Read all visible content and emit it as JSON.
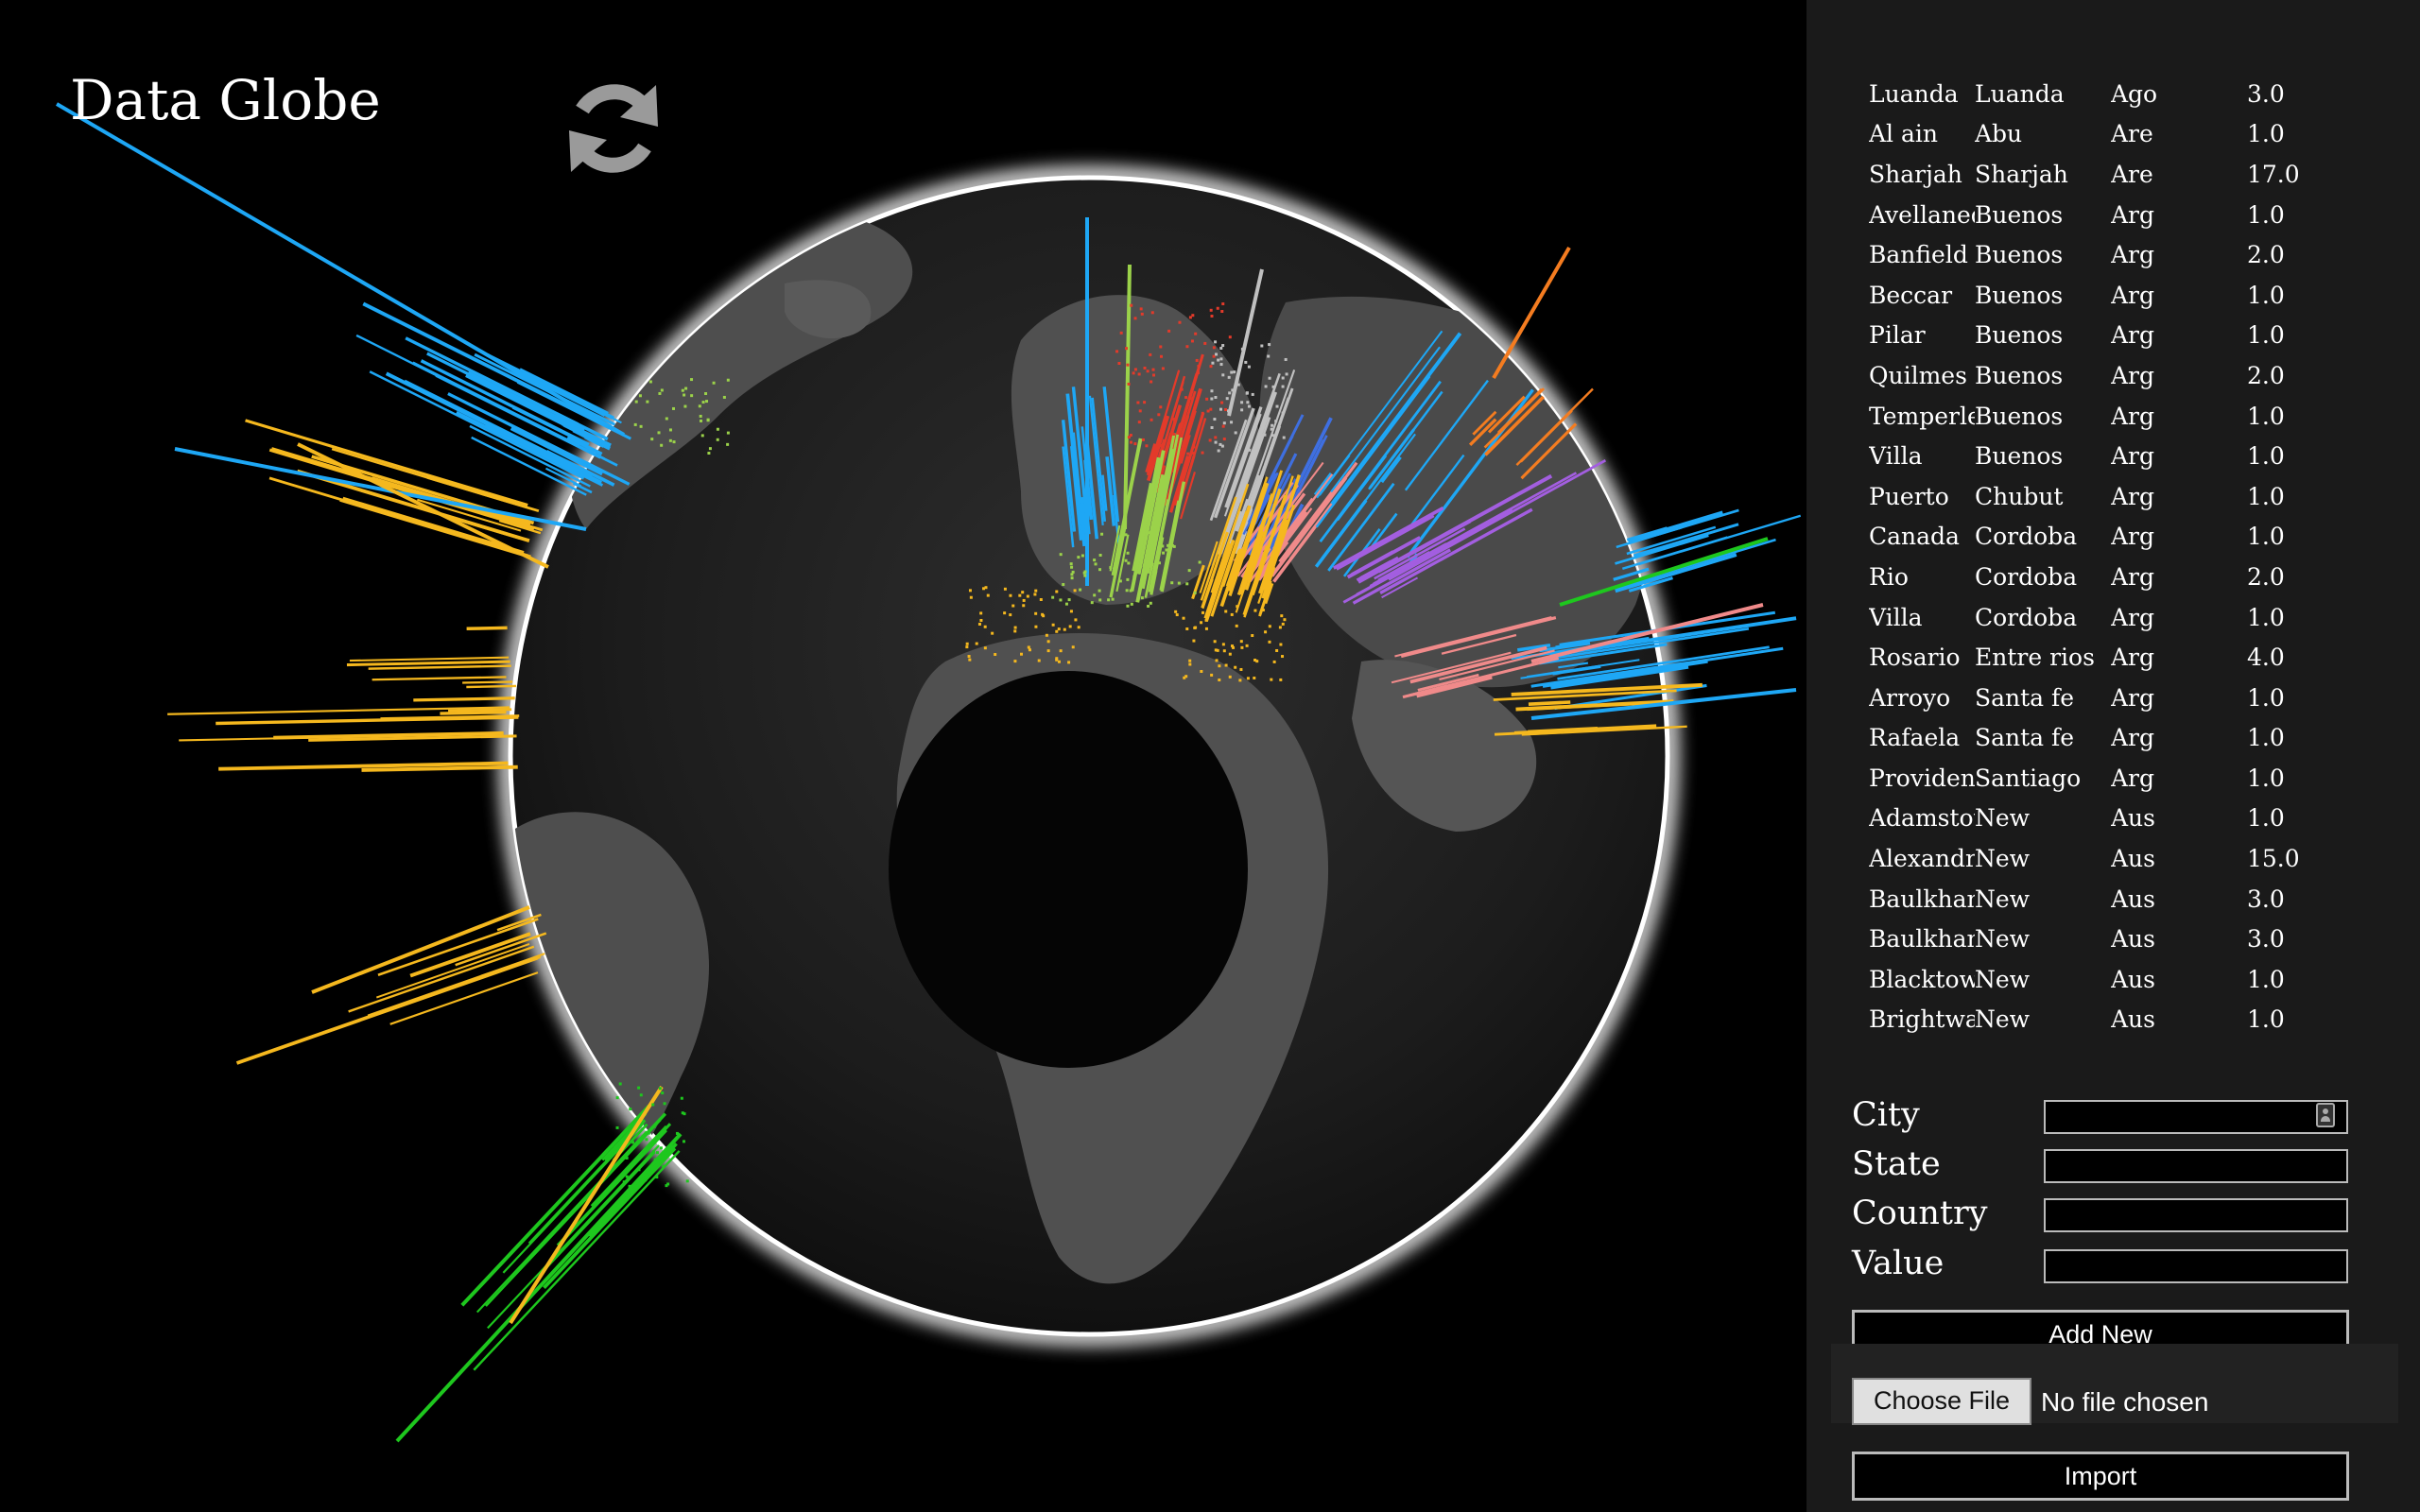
{
  "app": {
    "title": "Data Globe",
    "refresh_icon": "refresh-icon"
  },
  "colors": {
    "background": "#000000",
    "panel": "#1a1a1a",
    "globe": "#3a3a3a",
    "land": "#5a5a5a",
    "glow": "#ffffff",
    "series": [
      "#1ea7f5",
      "#f5b81e",
      "#1ec71e",
      "#9bd24a",
      "#e33a2a",
      "#f08a8a",
      "#c0c0c0",
      "#a35ee0",
      "#f47c20",
      "#3f6fe0"
    ]
  },
  "table": {
    "rows": [
      {
        "city": "Luanda",
        "state": "Luanda",
        "country": "Ago",
        "value": "3.0"
      },
      {
        "city": "Al ain",
        "state": "Abu",
        "country": "Are",
        "value": "1.0"
      },
      {
        "city": "Sharjah",
        "state": "Sharjah",
        "country": "Are",
        "value": "17.0"
      },
      {
        "city": "Avellaneda",
        "state": "Buenos",
        "country": "Arg",
        "value": "1.0"
      },
      {
        "city": "Banfield",
        "state": "Buenos",
        "country": "Arg",
        "value": "2.0"
      },
      {
        "city": "Beccar",
        "state": "Buenos",
        "country": "Arg",
        "value": "1.0"
      },
      {
        "city": "Pilar",
        "state": "Buenos",
        "country": "Arg",
        "value": "1.0"
      },
      {
        "city": "Quilmes",
        "state": "Buenos",
        "country": "Arg",
        "value": "2.0"
      },
      {
        "city": "Temperley",
        "state": "Buenos",
        "country": "Arg",
        "value": "1.0"
      },
      {
        "city": "Villa",
        "state": "Buenos",
        "country": "Arg",
        "value": "1.0"
      },
      {
        "city": "Puerto",
        "state": "Chubut",
        "country": "Arg",
        "value": "1.0"
      },
      {
        "city": "Canada",
        "state": "Cordoba",
        "country": "Arg",
        "value": "1.0"
      },
      {
        "city": "Rio",
        "state": "Cordoba",
        "country": "Arg",
        "value": "2.0"
      },
      {
        "city": "Villa",
        "state": "Cordoba",
        "country": "Arg",
        "value": "1.0"
      },
      {
        "city": "Rosario",
        "state": "Entre rios",
        "country": "Arg",
        "value": "4.0"
      },
      {
        "city": "Arroyo",
        "state": "Santa fe",
        "country": "Arg",
        "value": "1.0"
      },
      {
        "city": "Rafaela",
        "state": "Santa fe",
        "country": "Arg",
        "value": "1.0"
      },
      {
        "city": "Providencia",
        "state": "Santiago",
        "country": "Arg",
        "value": "1.0"
      },
      {
        "city": "Adamstown",
        "state": "New",
        "country": "Aus",
        "value": "1.0"
      },
      {
        "city": "Alexandria",
        "state": "New",
        "country": "Aus",
        "value": "15.0"
      },
      {
        "city": "Baulkham",
        "state": "New",
        "country": "Aus",
        "value": "3.0"
      },
      {
        "city": "Baulkham",
        "state": "New",
        "country": "Aus",
        "value": "3.0"
      },
      {
        "city": "Blacktown",
        "state": "New",
        "country": "Aus",
        "value": "1.0"
      },
      {
        "city": "Brightwater",
        "state": "New",
        "country": "Aus",
        "value": "1.0"
      }
    ]
  },
  "form": {
    "city_label": "City",
    "state_label": "State",
    "country_label": "Country",
    "value_label": "Value",
    "city_value": "",
    "state_value": "",
    "country_value": "",
    "value_value": "",
    "add_button": "Add New",
    "choose_file_button": "Choose File",
    "file_status": "No file chosen",
    "import_button": "Import"
  }
}
